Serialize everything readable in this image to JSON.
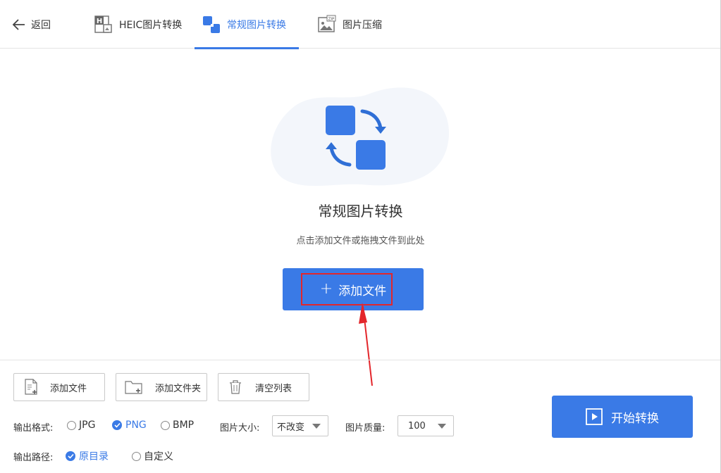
{
  "header": {
    "back_label": "返回",
    "tabs": [
      {
        "label": "HEIC图片转换",
        "icon": "heic-file-icon"
      },
      {
        "label": "常规图片转换",
        "icon": "convert-images-icon",
        "active": true
      },
      {
        "label": "图片压缩",
        "icon": "zip-image-icon"
      }
    ]
  },
  "dropzone": {
    "title": "常规图片转换",
    "subtitle": "点击添加文件或拖拽文件到此处",
    "add_button_label": "添加文件"
  },
  "toolbar": {
    "add_file_label": "添加文件",
    "add_folder_label": "添加文件夹",
    "clear_list_label": "清空列表"
  },
  "options": {
    "format_label": "输出格式:",
    "formats": [
      {
        "label": "JPG",
        "selected": false
      },
      {
        "label": "PNG",
        "selected": true
      },
      {
        "label": "BMP",
        "selected": false
      }
    ],
    "size_label": "图片大小:",
    "size_value": "不改变",
    "quality_label": "图片质量:",
    "quality_value": "100",
    "path_label": "输出路径:",
    "paths": [
      {
        "label": "原目录",
        "selected": true
      },
      {
        "label": "自定义",
        "selected": false
      }
    ]
  },
  "start_button_label": "开始转换",
  "colors": {
    "accent": "#3a7ae6",
    "highlight": "#e3262b"
  }
}
